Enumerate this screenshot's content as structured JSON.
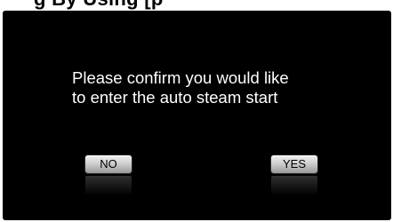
{
  "header": {
    "cropped_text": "g  By Using  [p"
  },
  "dialog": {
    "message_line1": "Please confirm you would like",
    "message_line2": "to enter the auto steam start"
  },
  "buttons": {
    "no_label": "NO",
    "yes_label": "YES"
  },
  "colors": {
    "screen_background": "#000000",
    "text": "#ffffff",
    "button_face": "#cfcfcf"
  }
}
